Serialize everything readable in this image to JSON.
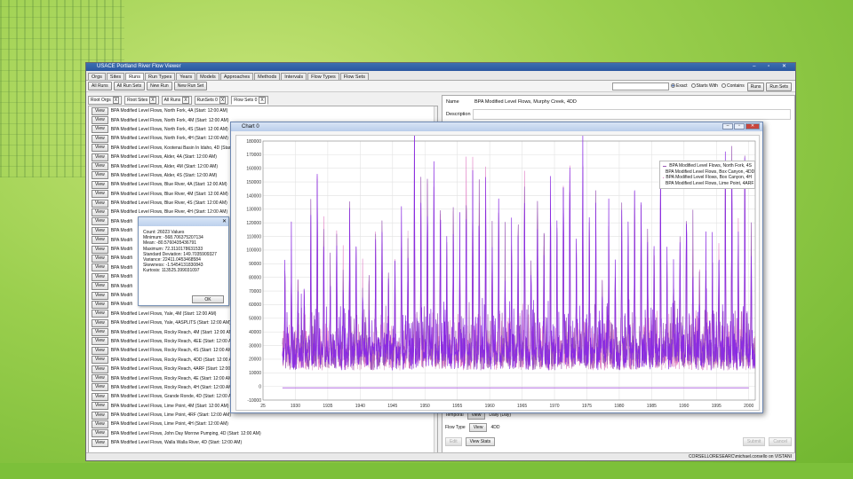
{
  "window": {
    "title": "USACE Portland River Flow Viewer",
    "controls": "– ▫ ✕"
  },
  "tabs": [
    "Orgs",
    "Sites",
    "Runs",
    "Run Types",
    "Years",
    "Models",
    "Approaches",
    "Methods",
    "Intervals",
    "Flow Types",
    "Flow Sets"
  ],
  "active_tab": "Runs",
  "toolbar": {
    "buttons": [
      "All Runs",
      "All Run Sets",
      "New Run",
      "New Run Set"
    ],
    "radio_exact": "Exact",
    "radio_starts": "Starts With",
    "radio_contains": "Contains",
    "runs_btn": "Runs",
    "runsets_btn": "Run Sets"
  },
  "filters": {
    "chips": [
      "Root Orgs",
      "Root Sites",
      "All Runs",
      "RunSets 0"
    ],
    "active": "Flow Sets 0",
    "x": "X"
  },
  "list": {
    "view_label": "View",
    "items": [
      "BPA Modified Level Flows, North Fork, 4A (Start: 12:00 AM)",
      "BPA Modified Level Flows, North Fork, 4M (Start: 12:00 AM)",
      "BPA Modified Level Flows, North Fork, 4S (Start: 12:00 AM)",
      "BPA Modified Level Flows, North Fork, 4H (Start: 12:00 AM)",
      "BPA Modified Level Flows, Kootenai Basin In Idaho, 4D (Start",
      "BPA Modified Level Flows, Alder, 4A (Start: 12:00 AM)",
      "BPA Modified Level Flows, Alder, 4M (Start: 12:00 AM)",
      "BPA Modified Level Flows, Alder, 4S (Start: 12:00 AM)",
      "BPA Modified Level Flows, Blue River, 4A (Start: 12:00 AM)",
      "BPA Modified Level Flows, Blue River, 4M (Start: 12:00 AM)",
      "BPA Modified Level Flows, Blue River, 4S (Start: 12:00 AM)",
      "BPA Modified Level Flows, Blue River, 4H (Start: 12:00 AM)",
      "BPA Modifi",
      "BPA Modifi",
      "BPA Modifi",
      "BPA Modifi",
      "BPA Modifi",
      "BPA Modifi",
      "BPA Modifi",
      "BPA Modifi",
      "BPA Modifi",
      "BPA Modifi",
      "BPA Modified Level Flows, Yale, 4M (Start: 12:00 AM)",
      "BPA Modified Level Flows, Yale, 4ASPLITS (Start: 12:00 AM)",
      "BPA Modified Level Flows, Rocky Reach, 4M (Start: 12:00 AM)",
      "BPA Modified Level Flows, Rocky Reach, 4EE (Start: 12:00 AM)",
      "BPA Modified Level Flows, Rocky Reach, 4S (Start: 12:00 AM)",
      "BPA Modified Level Flows, Rocky Reach, 4DD (Start: 12:00 AM)",
      "BPA Modified Level Flows, Rocky Reach, 4ARF (Start: 12:00 AM)",
      "BPA Modified Level Flows, Rocky Reach, 4E (Start: 12:00 AM)",
      "BPA Modified Level Flows, Rocky Reach, 4H (Start: 12:00 AM)",
      "BPA Modified Level Flows, Grande Ronde, 4D (Start: 12:00 AM)",
      "BPA Modified Level Flows, Lime Point, 4M (Start: 12:00 AM)",
      "BPA Modified Level Flows, Lime Point, 4RF (Start: 12:00 AM)",
      "BPA Modified Level Flows, Lime Point, 4H (Start: 12:00 AM)",
      "BPA Modified Level Flows, John Day Morrow Pumping, 4D (Start: 12:00 AM)",
      "BPA Modified Level Flows, Walla Walla River, 4D (Start: 12:00 AM)"
    ]
  },
  "details": {
    "name_label": "Name",
    "name_value": "BPA Modified Level Flows, Murphy Creek, 4DD",
    "desc_label": "Description",
    "temporal_label": "Temporal",
    "temporal_value": "Daily (Day)",
    "flowtype_label": "Flow Type",
    "flowtype_value": "4DD",
    "edit_btn": "Edit",
    "viewstats_btn": "View Stats",
    "submit_btn": "Submit",
    "cancel_btn": "Cancel"
  },
  "stats_dialog": {
    "lines": [
      "Count: 26023 Values",
      "Minimum: -568.706375207134",
      "Mean: -80.5760435436791",
      "Maximum: 72.3110178631533",
      "Standard Deviation: 149.7035909327",
      "Variance: 22411.0453468584",
      "Skewness: -1.5454131830843",
      "Kurtosis: 113525.399031097"
    ],
    "ok": "OK",
    "close": "✕"
  },
  "statusbar": "CORSELLORESEARC\\michael.corsello on VISTANI",
  "chart_window": {
    "title": "Chart 0"
  },
  "chart_data": {
    "type": "line",
    "title": "",
    "xlim": [
      1925,
      2001
    ],
    "ylim": [
      -10000,
      180000
    ],
    "x_ticks": [
      "25",
      "1930",
      "1935",
      "1940",
      "1945",
      "1950",
      "1955",
      "1960",
      "1965",
      "1970",
      "1975",
      "1980",
      "1985",
      "1990",
      "1995",
      "2000"
    ],
    "y_ticks": [
      "-10000",
      "0",
      "10000",
      "20000",
      "30000",
      "40000",
      "50000",
      "60000",
      "70000",
      "80000",
      "90000",
      "100000",
      "110000",
      "120000",
      "130000",
      "140000",
      "150000",
      "160000",
      "170000",
      "180000"
    ],
    "series": [
      {
        "name": "BPA Modified Level Flows, North Fork, 4S",
        "color": "#9b59b6"
      },
      {
        "name": "BPA Modified Level Flows, Box Canyon, 4DD",
        "color": "#d9a0c8"
      },
      {
        "name": "BPA Modified Level Flows, Box Canyon, 4H",
        "color": "#e07cc4"
      },
      {
        "name": "BPA Modified Level Flows, Lime Point, 4ARF",
        "color": "#8a2be2"
      }
    ],
    "annual_peaks": [
      [
        1928,
        72000
      ],
      [
        1929,
        75000
      ],
      [
        1930,
        55000
      ],
      [
        1931,
        48000
      ],
      [
        1932,
        115000
      ],
      [
        1933,
        130000
      ],
      [
        1934,
        100000
      ],
      [
        1935,
        60000
      ],
      [
        1936,
        95000
      ],
      [
        1937,
        68000
      ],
      [
        1938,
        110000
      ],
      [
        1939,
        80000
      ],
      [
        1940,
        58000
      ],
      [
        1941,
        52000
      ],
      [
        1942,
        85000
      ],
      [
        1943,
        122000
      ],
      [
        1944,
        60000
      ],
      [
        1945,
        74000
      ],
      [
        1946,
        108000
      ],
      [
        1947,
        102000
      ],
      [
        1948,
        168000
      ],
      [
        1949,
        118000
      ],
      [
        1950,
        145000
      ],
      [
        1951,
        128000
      ],
      [
        1952,
        112000
      ],
      [
        1953,
        90000
      ],
      [
        1954,
        118000
      ],
      [
        1955,
        85000
      ],
      [
        1956,
        152000
      ],
      [
        1957,
        130000
      ],
      [
        1958,
        126000
      ],
      [
        1959,
        128000
      ],
      [
        1960,
        98000
      ],
      [
        1961,
        120000
      ],
      [
        1962,
        80000
      ],
      [
        1963,
        92000
      ],
      [
        1964,
        98000
      ],
      [
        1965,
        140000
      ],
      [
        1966,
        82000
      ],
      [
        1967,
        125000
      ],
      [
        1968,
        98000
      ],
      [
        1969,
        132000
      ],
      [
        1970,
        110000
      ],
      [
        1971,
        140000
      ],
      [
        1972,
        158000
      ],
      [
        1973,
        85000
      ],
      [
        1974,
        160000
      ],
      [
        1975,
        105000
      ],
      [
        1976,
        112000
      ],
      [
        1977,
        60000
      ],
      [
        1978,
        92000
      ],
      [
        1979,
        70000
      ],
      [
        1980,
        115000
      ],
      [
        1981,
        98000
      ],
      [
        1982,
        130000
      ],
      [
        1983,
        128000
      ],
      [
        1984,
        105000
      ],
      [
        1985,
        88000
      ],
      [
        1986,
        142000
      ],
      [
        1987,
        68000
      ],
      [
        1988,
        62000
      ],
      [
        1989,
        98000
      ],
      [
        1990,
        120000
      ],
      [
        1991,
        88000
      ],
      [
        1992,
        60000
      ],
      [
        1993,
        72000
      ],
      [
        1994,
        65000
      ],
      [
        1995,
        92000
      ],
      [
        1996,
        155000
      ],
      [
        1997,
        162000
      ],
      [
        1998,
        108000
      ],
      [
        1999,
        145000
      ],
      [
        2000,
        92000
      ]
    ],
    "baseline": 17000,
    "lower_series_value": -1000
  }
}
